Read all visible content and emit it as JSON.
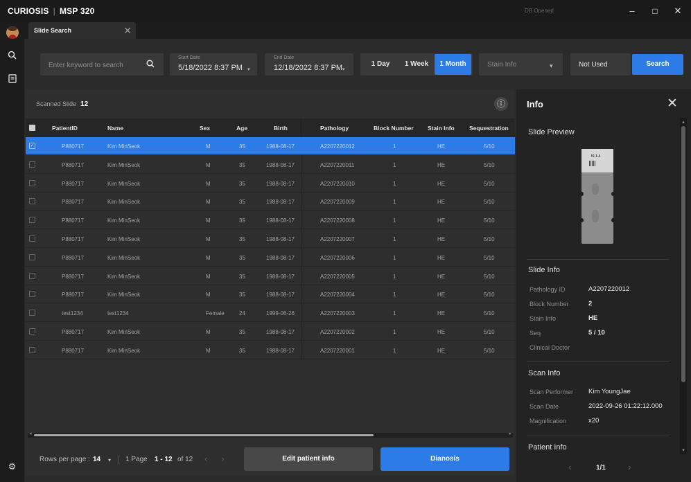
{
  "app": {
    "name": "CURIOSIS",
    "product": "MSP 320",
    "db_status": "DB Opened",
    "controls": {
      "minimize": "–",
      "maximize": "□",
      "close": "✕"
    }
  },
  "tab": {
    "label": "Slide Search",
    "close": "✕"
  },
  "search": {
    "placeholder": "Enter keyword to search",
    "start_label": "Start Date",
    "start_value": "5/18/2022 8:37 PM",
    "end_label": "End Date",
    "end_value": "12/18/2022 8:37 PM",
    "periods": [
      "1 Day",
      "1 Week",
      "1 Month"
    ],
    "stain_placeholder": "Stain Info",
    "status_value": "Not Used",
    "search_label": "Search",
    "caret": "▾",
    "search_icon": "🔍"
  },
  "list": {
    "scanned_label": "Scanned Slide",
    "scanned_count": "12",
    "info_glyph": "ⓘ",
    "columns": [
      "PatientID",
      "Name",
      "Sex",
      "Age",
      "Birth",
      "Pathology",
      "Block Number",
      "Stain Info",
      "Sequestration"
    ],
    "rows": [
      [
        "P880717",
        "Kim MinSeok",
        "M",
        "35",
        "1988-08-17",
        "A2207220012",
        "1",
        "HE",
        "5/10"
      ],
      [
        "P880717",
        "Kim MinSeok",
        "M",
        "35",
        "1988-08-17",
        "A2207220011",
        "1",
        "HE",
        "5/10"
      ],
      [
        "P880717",
        "Kim MinSeok",
        "M",
        "35",
        "1988-08-17",
        "A2207220010",
        "1",
        "HE",
        "5/10"
      ],
      [
        "P880717",
        "Kim MinSeok",
        "M",
        "35",
        "1988-08-17",
        "A2207220009",
        "1",
        "HE",
        "5/10"
      ],
      [
        "P880717",
        "Kim MinSeok",
        "M",
        "35",
        "1988-08-17",
        "A2207220008",
        "1",
        "HE",
        "5/10"
      ],
      [
        "P880717",
        "Kim MinSeok",
        "M",
        "35",
        "1988-08-17",
        "A2207220007",
        "1",
        "HE",
        "5/10"
      ],
      [
        "P880717",
        "Kim MinSeok",
        "M",
        "35",
        "1988-08-17",
        "A2207220006",
        "1",
        "HE",
        "5/10"
      ],
      [
        "P880717",
        "Kim MinSeok",
        "M",
        "35",
        "1988-08-17",
        "A2207220005",
        "1",
        "HE",
        "5/10"
      ],
      [
        "P880717",
        "Kim MinSeok",
        "M",
        "35",
        "1988-08-17",
        "A2207220004",
        "1",
        "HE",
        "5/10"
      ],
      [
        "test1234",
        "test1234",
        "Female",
        "24",
        "1999-06-26",
        "A2207220003",
        "1",
        "HE",
        "5/10"
      ],
      [
        "P880717",
        "Kim MinSeok",
        "M",
        "35",
        "1988-08-17",
        "A2207220002",
        "1",
        "HE",
        "5/10"
      ],
      [
        "P880717",
        "Kim MinSeok",
        "M",
        "35",
        "1988-08-17",
        "A2207220001",
        "1",
        "HE",
        "5/10"
      ]
    ],
    "selected_row": 0
  },
  "pagination": {
    "rows_label": "Rows per page :",
    "rows_value": "14",
    "page_label": "1 Page",
    "range": "1 - 12",
    "of_label": "of 12",
    "prev": "‹",
    "next": "›"
  },
  "actions": {
    "edit_label": "Edit patient info",
    "diagnosis_label": "Dianosis"
  },
  "info": {
    "title": "Info",
    "close": "✕",
    "preview_title": "Slide Preview",
    "preview_label": "IS 1-4",
    "slide_info_title": "Slide Info",
    "slide_info": [
      {
        "label": "Pathology ID",
        "value": "A2207220012"
      },
      {
        "label": "Block Number",
        "value": "2"
      },
      {
        "label": "Stain Info",
        "value": "HE"
      },
      {
        "label": "Seq",
        "value": "5 / 10"
      },
      {
        "label": "Clinical Doctor",
        "value": ""
      }
    ],
    "scan_info_title": "Scan Info",
    "scan_info": [
      {
        "label": "Scan Performer",
        "value": "Kim YoungJae"
      },
      {
        "label": "Scan Date",
        "value": "2022-09-26 01:22:12.000"
      },
      {
        "label": "Magnification",
        "value": "x20"
      }
    ],
    "patient_info_title": "Patient Info",
    "page": "1/1",
    "prev": "‹",
    "next": "›"
  },
  "colors": {
    "accent": "#2d7be6",
    "background": "#2b2b2b",
    "panel": "#232323"
  }
}
